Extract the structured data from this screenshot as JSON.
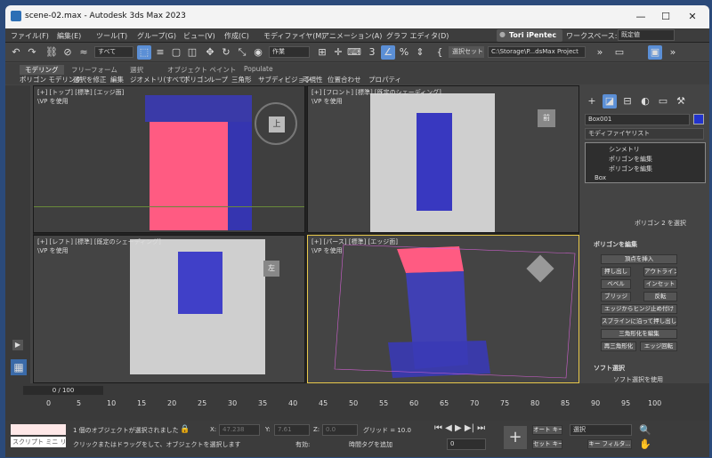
{
  "window": {
    "title": "scene-02.max - Autodesk 3ds Max 2023",
    "min": "—",
    "max": "☐",
    "close": "✕"
  },
  "menu": [
    "ファイル(F)",
    "編集(E)",
    "ツール(T)",
    "グループ(G)",
    "ビュー(V)",
    "作成(C)",
    "モディファイヤ(M)",
    "アニメーション(A)",
    "グラフ エディタ(D)"
  ],
  "user": "Tori iPentec",
  "workspace_label": "ワークスペース:",
  "workspace": "既定値",
  "toolbar": {
    "filter": "すべて",
    "selset": "作業",
    "selset_btn": "選択セット",
    "path": "C:\\Storage\\P...dsMax Project"
  },
  "ribbon": {
    "tabs": [
      "モデリング",
      "フリーフォーム",
      "選択",
      "オブジェクト ペイント",
      "Populate"
    ],
    "sub": [
      "ポリゴン モデリング",
      "選択を修正",
      "編集",
      "ジオメトリ(すべて)",
      "ポリゴン",
      "ループ",
      "三角形",
      "サブディビジョン",
      "可視性",
      "位置合わせ",
      "プロパティ"
    ]
  },
  "viewports": {
    "top": "[+] [トップ] [標準] [エッジ面]",
    "front": "[+] [フロント] [標準] [既定のシェーディング]",
    "left": "[+] [レフト] [標準] [既定のシェーディング]",
    "persp": "[+] [パース] [標準] [エッジ面]",
    "sub": "\\VP を使用",
    "cube_top": "上",
    "cube_front": "前",
    "cube_left": "左"
  },
  "command": {
    "object_name": "Box001",
    "modlist": "モディファイヤリスト",
    "stack": [
      "シンメトリ",
      "ポリゴンを編集",
      "ポリゴンを編集",
      "Box"
    ],
    "sel_info": "ポリゴン 2 を選択",
    "edit_poly": "ポリゴンを編集",
    "btns": {
      "insert": "頂点を挿入",
      "extrude": "押し出し",
      "outline": "アウトライン",
      "bevel": "ベベル",
      "inset": "インセット",
      "bridge": "ブリッジ",
      "flip": "反転",
      "hinge": "エッジからヒンジ止め付け",
      "spline": "スプラインに沿って押し出し",
      "tri": "三角形化を編集",
      "retri": "再三角形化",
      "turn": "エッジ回転"
    },
    "soft": "ソフト選択",
    "soft_use": "ソフト選択を使用"
  },
  "timeline": {
    "frame": "0 / 100",
    "ticks": [
      "0",
      "5",
      "10",
      "15",
      "20",
      "25",
      "30",
      "35",
      "40",
      "45",
      "50",
      "55",
      "60",
      "65",
      "70",
      "75",
      "80",
      "85",
      "90",
      "95",
      "100"
    ]
  },
  "status": {
    "script": "スクリプト ミニ リス",
    "selected": "1 個のオブジェクトが選択されました",
    "hint": "クリックまたはドラッグをして、オブジェクトを選択します",
    "x": "47.238",
    "y": "7.61",
    "z": "0.0",
    "grid": "グリッド = 10.0",
    "enabled": "有効:",
    "timetag": "時間タグを追加",
    "autokey": "オート キー",
    "setkey": "セット キー",
    "selmode": "選択",
    "keyfilter": "キー フィルタ...",
    "frame_field": "0"
  }
}
